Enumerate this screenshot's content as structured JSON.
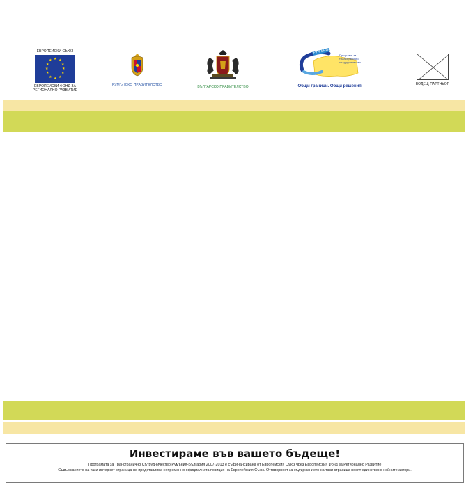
{
  "header": {
    "logos": [
      {
        "id": "eu",
        "top_caption": "ЕВРОПЕЙСКИ СЪЮЗ",
        "caption_lines": [
          "ЕВРОПЕЙСКИ ФОНД ЗА",
          "РЕГИОНАЛНО РАЗВИТИЕ"
        ],
        "icon": "eu-flag-icon"
      },
      {
        "id": "ro",
        "caption": "РУМЪНСКО ПРАВИТЕЛСТВО",
        "icon": "romania-coat-of-arms-icon"
      },
      {
        "id": "bg",
        "caption": "БЪЛГАРСКО ПРАВИТЕЛСТВО",
        "icon": "bulgaria-coat-of-arms-icon"
      },
      {
        "id": "programme",
        "ribbon": "РУМЪНИЯ - БЪЛГАРИЯ",
        "side_text": "Програма за трансгранично сътрудничество",
        "caption": "Общи граници. Общи решения.",
        "icon": "cross-border-map-icon"
      },
      {
        "id": "lead",
        "caption": "ВОДЕЩ ПАРТНЬОР",
        "icon": "placeholder-cross-icon"
      }
    ]
  },
  "colors": {
    "cream_band": "#f7e6a4",
    "green_band": "#d2d957",
    "eu_blue": "#1f3d99",
    "eu_star": "#ffd700"
  },
  "footer": {
    "slogan": "Инвестираме във вашето бъдеще!",
    "line1": "Програмата за Трансгранично Сътрудничество Румъния-България 2007-2013 е съфинансирана от Европейския Съюз чрез Европейския Фонд за Регионално Развитие",
    "line2": "Съдържанието на тази интернет страница не представлява непременно официалната позиция на Европейския Съюз. Отговорност за съдържанието на тази страница носят единствено нейните автори."
  }
}
